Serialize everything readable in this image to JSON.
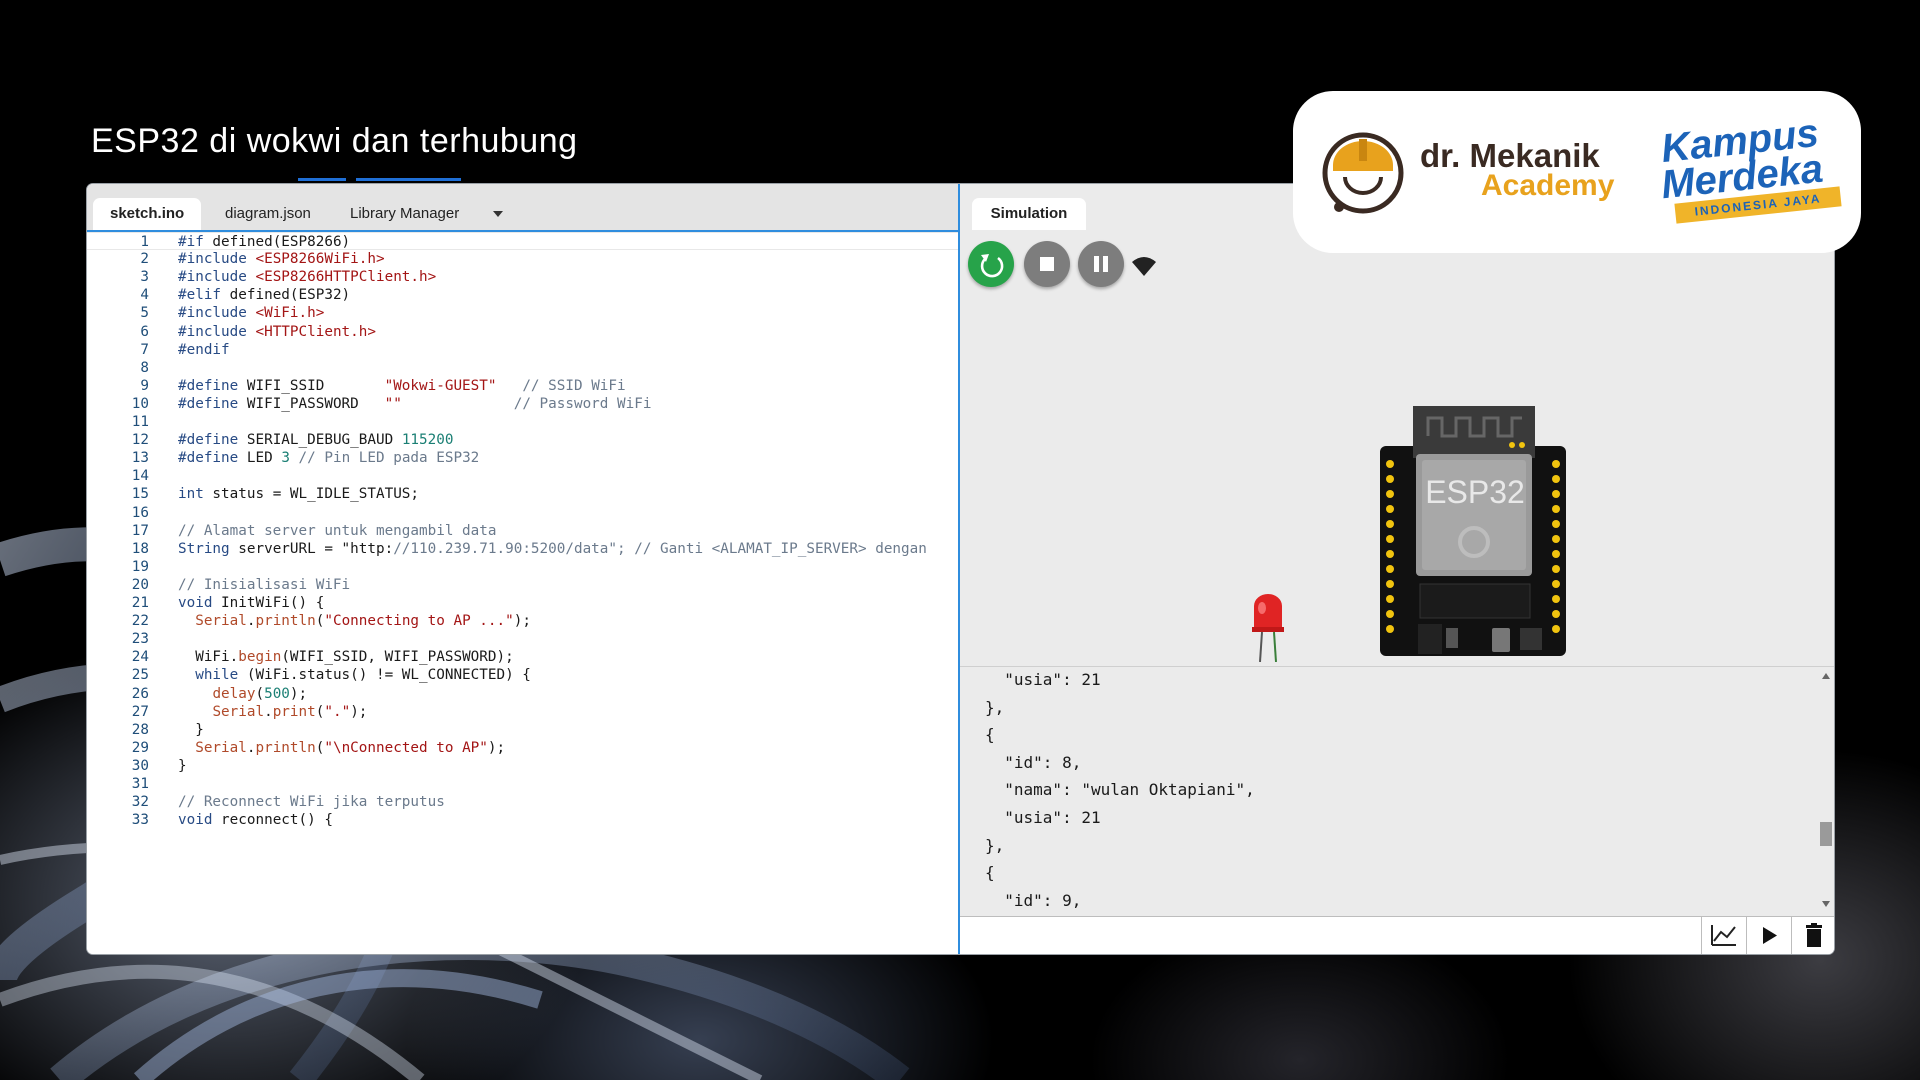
{
  "slide": {
    "title": "ESP32 di wokwi dan terhubung"
  },
  "logos": {
    "academy_line1": "dr. Mekanik",
    "academy_line2": "Academy",
    "kampus_line1": "Kampus",
    "kampus_line2": "Merdeka",
    "kampus_band": "INDONESIA JAYA",
    "brand_colors": {
      "academy_dark": "#3a2a22",
      "academy_orange": "#e8a21d",
      "kampus_blue": "#1c63b8",
      "kampus_yellow": "#f0b429"
    }
  },
  "editor": {
    "tabs": [
      {
        "label": "sketch.ino",
        "active": true
      },
      {
        "label": "diagram.json",
        "active": false
      },
      {
        "label": "Library Manager",
        "active": false
      }
    ],
    "lines": [
      {
        "n": "1",
        "text": "#if defined(ESP8266)"
      },
      {
        "n": "2",
        "text": "#include <ESP8266WiFi.h>"
      },
      {
        "n": "3",
        "text": "#include <ESP8266HTTPClient.h>"
      },
      {
        "n": "4",
        "text": "#elif defined(ESP32)"
      },
      {
        "n": "5",
        "text": "#include <WiFi.h>"
      },
      {
        "n": "6",
        "text": "#include <HTTPClient.h>"
      },
      {
        "n": "7",
        "text": "#endif"
      },
      {
        "n": "8",
        "text": ""
      },
      {
        "n": "9",
        "text": "#define WIFI_SSID       \"Wokwi-GUEST\"   // SSID WiFi"
      },
      {
        "n": "10",
        "text": "#define WIFI_PASSWORD   \"\"             // Password WiFi"
      },
      {
        "n": "11",
        "text": ""
      },
      {
        "n": "12",
        "text": "#define SERIAL_DEBUG_BAUD 115200"
      },
      {
        "n": "13",
        "text": "#define LED 3 // Pin LED pada ESP32"
      },
      {
        "n": "14",
        "text": ""
      },
      {
        "n": "15",
        "text": "int status = WL_IDLE_STATUS;"
      },
      {
        "n": "16",
        "text": ""
      },
      {
        "n": "17",
        "text": "// Alamat server untuk mengambil data"
      },
      {
        "n": "18",
        "text": "String serverURL = \"http://110.239.71.90:5200/data\"; // Ganti <ALAMAT_IP_SERVER> dengan"
      },
      {
        "n": "19",
        "text": ""
      },
      {
        "n": "20",
        "text": "// Inisialisasi WiFi"
      },
      {
        "n": "21",
        "text": "void InitWiFi() {"
      },
      {
        "n": "22",
        "text": "  Serial.println(\"Connecting to AP ...\");"
      },
      {
        "n": "23",
        "text": ""
      },
      {
        "n": "24",
        "text": "  WiFi.begin(WIFI_SSID, WIFI_PASSWORD);"
      },
      {
        "n": "25",
        "text": "  while (WiFi.status() != WL_CONNECTED) {"
      },
      {
        "n": "26",
        "text": "    delay(500);"
      },
      {
        "n": "27",
        "text": "    Serial.print(\".\");"
      },
      {
        "n": "28",
        "text": "  }"
      },
      {
        "n": "29",
        "text": "  Serial.println(\"\\nConnected to AP\");"
      },
      {
        "n": "30",
        "text": "}"
      },
      {
        "n": "31",
        "text": ""
      },
      {
        "n": "32",
        "text": "// Reconnect WiFi jika terputus"
      },
      {
        "n": "33",
        "text": "void reconnect() {"
      }
    ]
  },
  "simulation": {
    "tab_label": "Simulation",
    "controls": {
      "restart_icon": "restart-icon",
      "stop_icon": "stop-icon",
      "pause_icon": "pause-icon",
      "wifi_icon": "wifi-icon"
    },
    "board_label": "ESP32",
    "serial_lines": [
      "  \"usia\": 21",
      "},",
      "{",
      "  \"id\": 8,",
      "  \"nama\": \"wulan Oktapiani\",",
      "  \"usia\": 21",
      "},",
      "{",
      "  \"id\": 9,"
    ],
    "serial_input_value": "",
    "serial_buttons": {
      "plotter_icon": "plotter-icon",
      "run_icon": "play-icon",
      "clear_icon": "trash-icon"
    }
  }
}
